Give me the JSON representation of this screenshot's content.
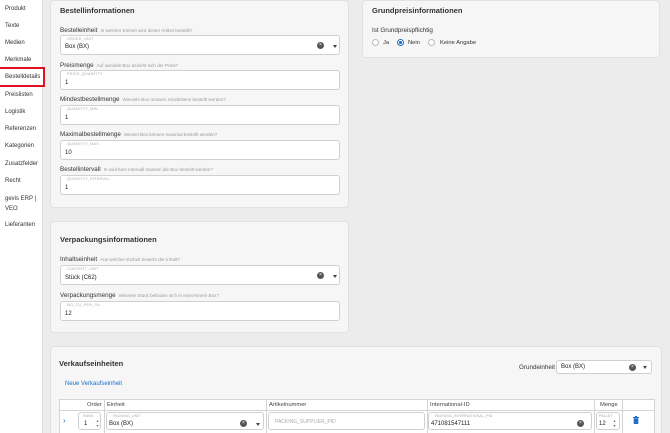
{
  "sidebar": {
    "items": [
      {
        "label": "Produkt"
      },
      {
        "label": "Texte"
      },
      {
        "label": "Medien"
      },
      {
        "label": "Merkmale"
      },
      {
        "label": "Bestelldetails",
        "active": true
      },
      {
        "label": "Preislisten"
      },
      {
        "label": "Logistik"
      },
      {
        "label": "Referenzen"
      },
      {
        "label": "Kategorien"
      },
      {
        "label": "Zusatzfelder"
      },
      {
        "label": "Recht"
      },
      {
        "label": "gevis ERP |"
      },
      {
        "label": "VEO"
      },
      {
        "label": "Lieferanten"
      }
    ]
  },
  "order": {
    "title": "Bestellinformationen",
    "unit": {
      "label": "Bestelleinheit",
      "hint": "In welcher Einheit wird dieser Artikel bestellt?",
      "code": "ORDER_UNIT",
      "value": "Box (BX)"
    },
    "price_qty": {
      "label": "Preismenge",
      "hint": "Auf wieviele Box bezieht sich der Preis?",
      "code": "PRICE_QUANTITY",
      "value": "1"
    },
    "min_qty": {
      "label": "Mindestbestellmenge",
      "hint": "Wieviele Box müssen mindestens bestellt werden?",
      "code": "QUANTITY_MIN",
      "value": "1"
    },
    "max_qty": {
      "label": "Maximalbestellmenge",
      "hint": "Wieviel Box können maximal bestellt werden?",
      "code": "QUANTITY_MAX",
      "value": "10"
    },
    "interval": {
      "label": "Bestellintervall",
      "hint": "In welchem Intervall müssen die Box bestellt werden?",
      "code": "QUANTITY_INTERVAL",
      "value": "1"
    }
  },
  "base_price": {
    "title": "Grundpreisinformationen",
    "question": "Ist Grundpreispflichtig",
    "options": [
      {
        "label": "Ja",
        "checked": false
      },
      {
        "label": "Nein",
        "checked": true
      },
      {
        "label": "Keine Angabe",
        "checked": false
      }
    ]
  },
  "packaging": {
    "title": "Verpackungsinformationen",
    "content_unit": {
      "label": "Inhaltseinheit",
      "hint": "Aus welcher Einheit besteht der Inhalt?",
      "code": "CONTENT_UNIT",
      "value": "Stück (C62)"
    },
    "pack_qty": {
      "label": "Verpackungsmenge",
      "hint": "Wieviele Stück befinden sich in einer/einem Box?",
      "code": "NO_CU_PER_OU",
      "value": "12"
    }
  },
  "sales_units": {
    "title": "Verkaufseinheiten",
    "base_unit_label": "Grundeinheit",
    "base_unit_value": "Box (BX)",
    "new_link": "Neue Verkaufseinheit",
    "columns": [
      "Order",
      "Einheit",
      "Artikelnummer",
      "International-ID",
      "Menge"
    ],
    "row": {
      "order_code": "RANK",
      "order": "1",
      "unit_code": "PACKING_UNIT",
      "unit": "Box (BX)",
      "article_placeholder": "PACKING_SUPPLIER_PID",
      "intl_code": "PACKING_INTERNATIONAL_PID",
      "intl_id": "471081547111",
      "qty_code": "PALLET",
      "qty": "12"
    }
  }
}
